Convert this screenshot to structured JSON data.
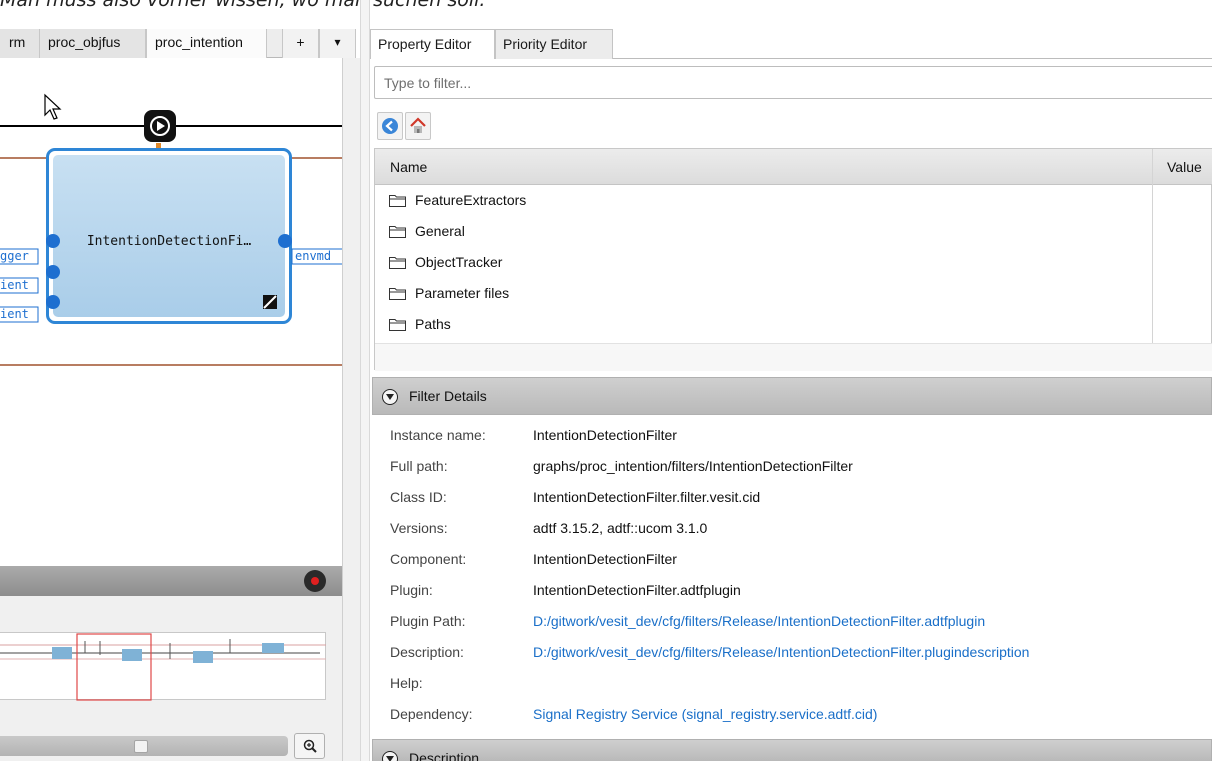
{
  "doc_caption": "Man muss also vorher wissen, wo man suchen soll.",
  "left_tabs": [
    {
      "label": "rm"
    },
    {
      "label": "proc_objfus"
    },
    {
      "label": "proc_intention"
    },
    {
      "label": "+"
    },
    {
      "label": "▾"
    }
  ],
  "graph": {
    "filter_title": "IntentionDetectionFi…",
    "input_ports": [
      "gger",
      "ient",
      "ient"
    ],
    "output_ports": [
      "envmd"
    ],
    "colors": {
      "port": "#1e6fd0",
      "box_border": "#2e86d6",
      "pin_line": "#a0522d"
    }
  },
  "right_tabs": [
    {
      "label": "Property Editor"
    },
    {
      "label": "Priority Editor"
    }
  ],
  "filter": {
    "placeholder": "Type to filter..."
  },
  "nav": {
    "back_icon": "back-arrow-icon",
    "home_icon": "home-icon"
  },
  "table": {
    "headers": {
      "name": "Name",
      "value": "Value"
    },
    "rows": [
      {
        "label": "FeatureExtractors"
      },
      {
        "label": "General"
      },
      {
        "label": "ObjectTracker"
      },
      {
        "label": "Parameter files"
      },
      {
        "label": "Paths"
      }
    ]
  },
  "filter_details": {
    "title": "Filter Details",
    "items": [
      {
        "label": "Instance name:",
        "value": "IntentionDetectionFilter"
      },
      {
        "label": "Full path:",
        "value": "graphs/proc_intention/filters/IntentionDetectionFilter"
      },
      {
        "label": "Class ID:",
        "value": "IntentionDetectionFilter.filter.vesit.cid"
      },
      {
        "label": "Versions:",
        "value": "adtf 3.15.2, adtf::ucom 3.1.0"
      },
      {
        "label": "Component:",
        "value": "IntentionDetectionFilter"
      },
      {
        "label": "Plugin:",
        "value": "IntentionDetectionFilter.adtfplugin"
      },
      {
        "label": "Plugin Path:",
        "value": "D:/gitwork/vesit_dev/cfg/filters/Release/IntentionDetectionFilter.adtfplugin"
      },
      {
        "label": "Description:",
        "value": "D:/gitwork/vesit_dev/cfg/filters/Release/IntentionDetectionFilter.plugindescription"
      },
      {
        "label": "Help:",
        "value": ""
      },
      {
        "label": "Dependency:",
        "value": "Signal Registry Service (signal_registry.service.adtf.cid)"
      }
    ]
  },
  "description_section": {
    "title": "Description"
  },
  "colors": {
    "link": "#1a6fc8",
    "section_header": "#c4c4c4",
    "accent_blue": "#2e86d6"
  }
}
